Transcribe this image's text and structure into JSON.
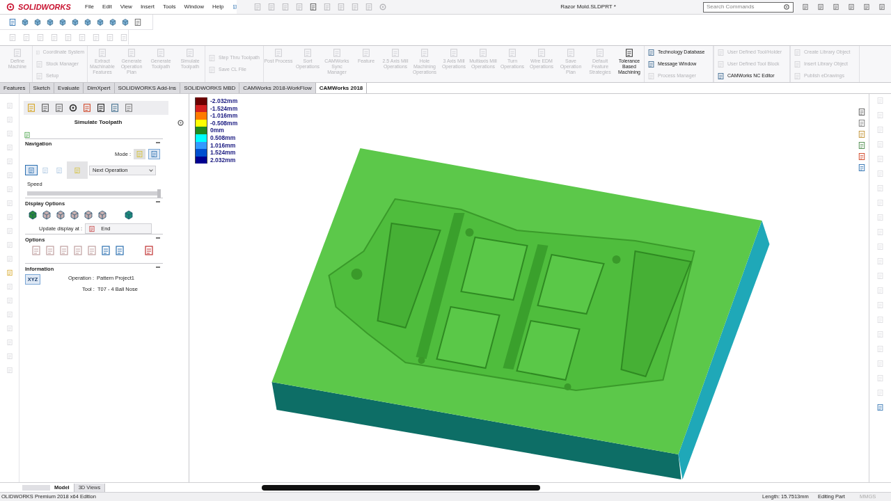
{
  "app": {
    "logo": "SOLIDWORKS",
    "menu": [
      "File",
      "Edit",
      "View",
      "Insert",
      "Tools",
      "Window",
      "Help"
    ],
    "title": "Razor Mold.SLDPRT *",
    "search": {
      "placeholder": "Search Commands"
    }
  },
  "ribbon": [
    {
      "kind": "large",
      "label": "Define Machine",
      "enabled": false
    },
    {
      "kind": "stack",
      "items": [
        {
          "label": "Coordinate System",
          "enabled": false
        },
        {
          "label": "Stock Manager",
          "enabled": false
        },
        {
          "label": "Setup",
          "enabled": false
        }
      ]
    },
    {
      "kind": "large",
      "label": "Extract Machinable Features",
      "enabled": false
    },
    {
      "kind": "large",
      "label": "Generate Operation Plan",
      "enabled": false
    },
    {
      "kind": "large",
      "label": "Generate Toolpath",
      "enabled": false
    },
    {
      "kind": "large",
      "label": "Simulate Toolpath",
      "enabled": false
    },
    {
      "kind": "stack",
      "items": [
        {
          "label": "Step Thru Toolpath",
          "enabled": false
        },
        {
          "label": "Save CL File",
          "enabled": false
        }
      ]
    },
    {
      "kind": "large",
      "label": "Post Process",
      "enabled": false
    },
    {
      "kind": "large",
      "label": "Sort Operations",
      "enabled": false
    },
    {
      "kind": "large",
      "label": "CAMWorks Sync Manager",
      "enabled": false
    },
    {
      "kind": "large",
      "label": "Feature",
      "enabled": false
    },
    {
      "kind": "large",
      "label": "2.5 Axis Mill Operations",
      "enabled": false
    },
    {
      "kind": "large",
      "label": "Hole Machining Operations",
      "enabled": false
    },
    {
      "kind": "large",
      "label": "3 Axis Mill Operations",
      "enabled": false
    },
    {
      "kind": "large",
      "label": "Multiaxis Mill Operations",
      "enabled": false
    },
    {
      "kind": "large",
      "label": "Turn Operations",
      "enabled": false
    },
    {
      "kind": "large",
      "label": "Wire EDM Operations",
      "enabled": false
    },
    {
      "kind": "large",
      "label": "Save Operation Plan",
      "enabled": false
    },
    {
      "kind": "large",
      "label": "Default Feature Strategies",
      "enabled": false
    },
    {
      "kind": "large",
      "label": "Tolerance Based Machining",
      "enabled": true
    },
    {
      "kind": "stack",
      "items": [
        {
          "label": "Technology Database",
          "enabled": true
        },
        {
          "label": "Message Window",
          "enabled": true
        },
        {
          "label": "Process Manager",
          "enabled": false
        }
      ]
    },
    {
      "kind": "stack",
      "items": [
        {
          "label": "User Defined Tool/Holder",
          "enabled": false
        },
        {
          "label": "User Defined Tool Block",
          "enabled": false
        },
        {
          "label": "CAMWorks NC Editor",
          "enabled": true
        }
      ]
    },
    {
      "kind": "stack",
      "items": [
        {
          "label": "Create Library Object",
          "enabled": false
        },
        {
          "label": "Insert Library Object",
          "enabled": false
        },
        {
          "label": "Publish eDrawings",
          "enabled": false
        }
      ]
    }
  ],
  "tabs": [
    {
      "label": "Features",
      "selected": false
    },
    {
      "label": "Sketch",
      "selected": false
    },
    {
      "label": "Evaluate",
      "selected": false
    },
    {
      "label": "DimXpert",
      "selected": false
    },
    {
      "label": "SOLIDWORKS Add-Ins",
      "selected": false
    },
    {
      "label": "SOLIDWORKS MBD",
      "selected": false
    },
    {
      "label": "CAMWorks 2018-WorkFlow",
      "selected": false
    },
    {
      "label": "CAMWorks 2018",
      "selected": true
    }
  ],
  "panel": {
    "title": "Simulate Toolpath",
    "navigation": {
      "title": "Navigation",
      "mode_label": "Mode :",
      "step_mode": "Next Operation",
      "speed_label": "Speed",
      "speed": {
        "level": 1.0
      }
    },
    "display_options": {
      "title": "Display Options",
      "update_label": "Update display at :",
      "update_value": "End"
    },
    "options": {
      "title": "Options"
    },
    "information": {
      "title": "Information",
      "button": "XYZ",
      "lines": [
        {
          "label": "Operation :",
          "value": "Pattern Project1"
        },
        {
          "label": "Tool :",
          "value": "T07 - 4 Ball Nose"
        }
      ]
    }
  },
  "legend": [
    {
      "label": "-2.032mm",
      "color": "#6b0000"
    },
    {
      "label": "-1.524mm",
      "color": "#d42020"
    },
    {
      "label": "-1.016mm",
      "color": "#ff7a00"
    },
    {
      "label": "-0.508mm",
      "color": "#ffff00"
    },
    {
      "label": "0mm",
      "color": "#1e8a1e"
    },
    {
      "label": "0.508mm",
      "color": "#00ffff"
    },
    {
      "label": "1.016mm",
      "color": "#3399ff"
    },
    {
      "label": "1.524mm",
      "color": "#0050d0"
    },
    {
      "label": "2.032mm",
      "color": "#000090"
    }
  ],
  "bottom_tabs": [
    {
      "label": "Model",
      "selected": true
    },
    {
      "label": "3D Views",
      "selected": false
    }
  ],
  "status_bar": {
    "edition": "OLIDWORKS Premium 2018 x64 Edition",
    "length": "Length: 15.7513mm",
    "mode": "Editing Part",
    "units": "MMGS"
  }
}
